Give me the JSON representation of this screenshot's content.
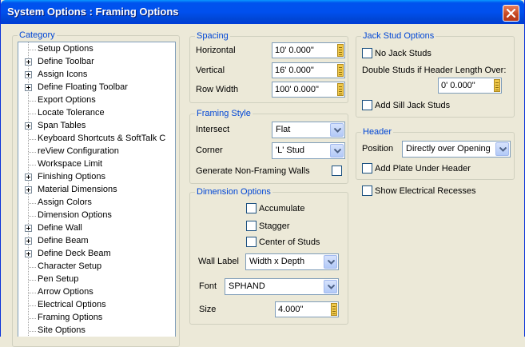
{
  "window": {
    "title": "System Options : Framing Options"
  },
  "category": {
    "label": "Category",
    "items": [
      {
        "label": "Setup Options",
        "expandable": false
      },
      {
        "label": "Define Toolbar",
        "expandable": true
      },
      {
        "label": "Assign Icons",
        "expandable": true
      },
      {
        "label": "Define Floating Toolbar",
        "expandable": true
      },
      {
        "label": "Export Options",
        "expandable": false
      },
      {
        "label": "Locate Tolerance",
        "expandable": false
      },
      {
        "label": "Span Tables",
        "expandable": true
      },
      {
        "label": "Keyboard Shortcuts & SoftTalk C",
        "expandable": false
      },
      {
        "label": "reView Configuration",
        "expandable": false
      },
      {
        "label": "Workspace Limit",
        "expandable": false
      },
      {
        "label": "Finishing Options",
        "expandable": true
      },
      {
        "label": "Material Dimensions",
        "expandable": true
      },
      {
        "label": "Assign Colors",
        "expandable": false
      },
      {
        "label": "Dimension Options",
        "expandable": false
      },
      {
        "label": "Define Wall",
        "expandable": true
      },
      {
        "label": "Define Beam",
        "expandable": true
      },
      {
        "label": "Define Deck Beam",
        "expandable": true
      },
      {
        "label": "Character Setup",
        "expandable": false
      },
      {
        "label": "Pen Setup",
        "expandable": false
      },
      {
        "label": "Arrow Options",
        "expandable": false
      },
      {
        "label": "Electrical Options",
        "expandable": false
      },
      {
        "label": "Framing Options",
        "expandable": false
      },
      {
        "label": "Site Options",
        "expandable": false
      }
    ]
  },
  "spacing": {
    "label": "Spacing",
    "horizontal_label": "Horizontal",
    "horizontal_value": "10' 0.000\"",
    "vertical_label": "Vertical",
    "vertical_value": "16' 0.000\"",
    "row_width_label": "Row Width",
    "row_width_value": "100' 0.000\""
  },
  "framing_style": {
    "label": "Framing Style",
    "intersect_label": "Intersect",
    "intersect_value": "Flat",
    "corner_label": "Corner",
    "corner_value": "'L' Stud",
    "non_framing_label": "Generate Non-Framing Walls",
    "non_framing_checked": false
  },
  "dimension_options": {
    "label": "Dimension Options",
    "accumulate_label": "Accumulate",
    "accumulate_checked": false,
    "stagger_label": "Stagger",
    "stagger_checked": false,
    "center_label": "Center of Studs",
    "center_checked": false,
    "wall_label_label": "Wall Label",
    "wall_label_value": "Width x Depth",
    "font_label": "Font",
    "font_value": "SPHAND",
    "size_label": "Size",
    "size_value": "4.000\""
  },
  "jack_stud": {
    "label": "Jack Stud Options",
    "no_jack_label": "No Jack Studs",
    "no_jack_checked": false,
    "double_label": "Double Studs if Header Length Over:",
    "double_value": "0' 0.000\"",
    "sill_label": "Add Sill Jack Studs",
    "sill_checked": false
  },
  "header": {
    "label": "Header",
    "position_label": "Position",
    "position_value": "Directly over Opening",
    "plate_label": "Add Plate Under Header",
    "plate_checked": false
  },
  "electrical": {
    "label": "Show Electrical Recesses",
    "checked": false
  }
}
